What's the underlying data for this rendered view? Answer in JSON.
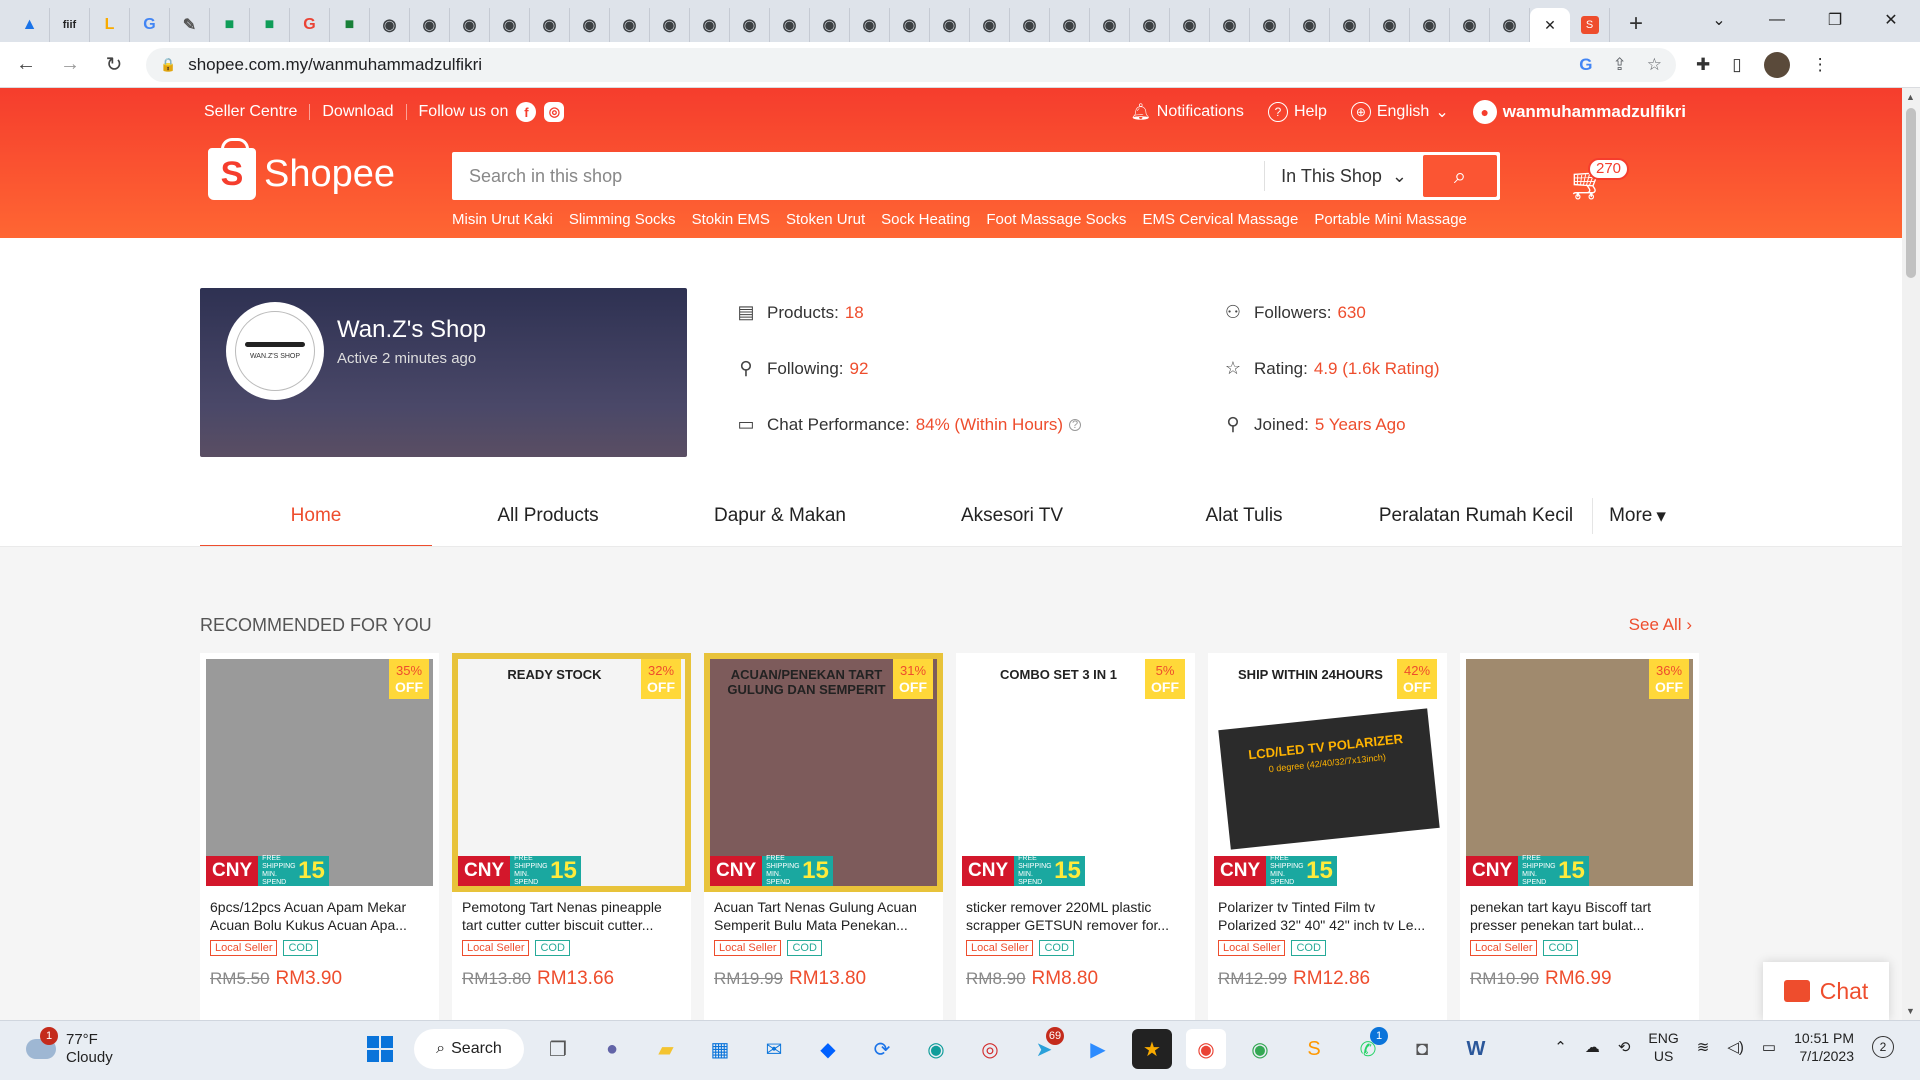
{
  "browser": {
    "tabs": [
      {
        "icon": "drive-icon",
        "char": "▲",
        "color": "#1a73e8"
      },
      {
        "icon": "fiif-icon",
        "char": "fiif",
        "color": "#222"
      },
      {
        "icon": "lucky-icon",
        "char": "L",
        "color": "#f9ab00"
      },
      {
        "icon": "translate-icon",
        "char": "G",
        "color": "#4285f4"
      },
      {
        "icon": "pen-icon",
        "char": "✎",
        "color": "#555"
      },
      {
        "icon": "classroom-icon",
        "char": "■",
        "color": "#0f9d58"
      },
      {
        "icon": "classroom-icon",
        "char": "■",
        "color": "#0f9d58"
      },
      {
        "icon": "google-icon",
        "char": "G",
        "color": "#ea4335"
      },
      {
        "icon": "classroom-icon",
        "char": "■",
        "color": "#188038"
      },
      {
        "icon": "globe-icon",
        "char": "◉",
        "color": "#3c4043"
      },
      {
        "icon": "globe-icon",
        "char": "◉",
        "color": "#3c4043"
      },
      {
        "icon": "globe-icon",
        "char": "◉",
        "color": "#3c4043"
      },
      {
        "icon": "globe-icon",
        "char": "◉",
        "color": "#3c4043"
      },
      {
        "icon": "globe-icon",
        "char": "◉",
        "color": "#3c4043"
      },
      {
        "icon": "globe-icon",
        "char": "◉",
        "color": "#3c4043"
      },
      {
        "icon": "globe-icon",
        "char": "◉",
        "color": "#3c4043"
      },
      {
        "icon": "globe-icon",
        "char": "◉",
        "color": "#3c4043"
      },
      {
        "icon": "globe-icon",
        "char": "◉",
        "color": "#3c4043"
      },
      {
        "icon": "globe-icon",
        "char": "◉",
        "color": "#3c4043"
      },
      {
        "icon": "globe-icon",
        "char": "◉",
        "color": "#3c4043"
      },
      {
        "icon": "globe-icon",
        "char": "◉",
        "color": "#3c4043"
      },
      {
        "icon": "globe-icon",
        "char": "◉",
        "color": "#3c4043"
      },
      {
        "icon": "globe-icon",
        "char": "◉",
        "color": "#3c4043"
      },
      {
        "icon": "globe-icon",
        "char": "◉",
        "color": "#3c4043"
      },
      {
        "icon": "globe-icon",
        "char": "◉",
        "color": "#3c4043"
      },
      {
        "icon": "globe-icon",
        "char": "◉",
        "color": "#3c4043"
      },
      {
        "icon": "globe-icon",
        "char": "◉",
        "color": "#3c4043"
      },
      {
        "icon": "globe-icon",
        "char": "◉",
        "color": "#3c4043"
      },
      {
        "icon": "globe-icon",
        "char": "◉",
        "color": "#3c4043"
      },
      {
        "icon": "globe-icon",
        "char": "◉",
        "color": "#3c4043"
      },
      {
        "icon": "globe-icon",
        "char": "◉",
        "color": "#3c4043"
      },
      {
        "icon": "globe-icon",
        "char": "◉",
        "color": "#3c4043"
      },
      {
        "icon": "globe-icon",
        "char": "◉",
        "color": "#3c4043"
      },
      {
        "icon": "globe-icon",
        "char": "◉",
        "color": "#3c4043"
      },
      {
        "icon": "globe-icon",
        "char": "◉",
        "color": "#3c4043"
      },
      {
        "icon": "globe-icon",
        "char": "◉",
        "color": "#3c4043"
      },
      {
        "icon": "globe-icon",
        "char": "◉",
        "color": "#3c4043"
      },
      {
        "icon": "globe-icon",
        "char": "◉",
        "color": "#3c4043"
      }
    ],
    "active_tab_close": "✕",
    "shopee_tab_char": "S",
    "new_tab": "+",
    "url": "shopee.com.my/wanmuhammadzulfikri"
  },
  "header": {
    "seller_centre": "Seller Centre",
    "download": "Download",
    "follow_us": "Follow us on",
    "notifications": "Notifications",
    "help": "Help",
    "language": "English",
    "username": "wanmuhammadzulfikri",
    "logo_text": "Shopee",
    "search_placeholder": "Search in this shop",
    "search_scope": "In This Shop",
    "cart_count": "270",
    "keywords": [
      "Misin Urut Kaki",
      "Slimming Socks",
      "Stokin EMS",
      "Stoken Urut",
      "Sock Heating",
      "Foot Massage Socks",
      "EMS Cervical Massage",
      "Portable Mini Massage"
    ]
  },
  "shop": {
    "name": "Wan.Z's Shop",
    "logo_text": "WAN.Z'S SHOP",
    "active": "Active 2 minutes ago",
    "stats": {
      "products_label": "Products:",
      "products": "18",
      "followers_label": "Followers:",
      "followers": "630",
      "following_label": "Following:",
      "following": "92",
      "rating_label": "Rating:",
      "rating": "4.9 (1.6k Rating)",
      "chat_label": "Chat Performance:",
      "chat": "84% (Within Hours)",
      "joined_label": "Joined:",
      "joined": "5 Years Ago"
    }
  },
  "tabs": [
    "Home",
    "All Products",
    "Dapur & Makan",
    "Aksesori TV",
    "Alat Tulis",
    "Peralatan Rumah Kecil"
  ],
  "more_tab": "More",
  "recommended": {
    "title": "RECOMMENDED FOR YOU",
    "see_all": "See All",
    "off_label": "OFF",
    "cny": "CNY",
    "free_ship": "FREE SHIPPING MIN. SPEND",
    "ship_amount": "15",
    "products": [
      {
        "title": "6pcs/12pcs Acuan Apam Mekar Acuan Bolu Kukus Acuan Apa...",
        "discount": "35%",
        "old_price": "RM5.50",
        "price": "RM3.90",
        "bg": "#9a9a9a",
        "frame": "#ffffff"
      },
      {
        "title": "Pemotong Tart Nenas pineapple tart cutter cutter biscuit cutter...",
        "discount": "32%",
        "old_price": "RM13.80",
        "price": "RM13.66",
        "bg": "#f4f4f4",
        "frame": "#e8c33a",
        "overlay": "READY STOCK"
      },
      {
        "title": "Acuan Tart Nenas Gulung Acuan Semperit Bulu Mata Penekan...",
        "discount": "31%",
        "old_price": "RM19.99",
        "price": "RM13.80",
        "bg": "#7d5b5b",
        "frame": "#e8c33a",
        "overlay": "ACUAN/PENEKAN TART GULUNG DAN SEMPERIT"
      },
      {
        "title": "sticker remover 220ML plastic scrapper GETSUN remover for...",
        "discount": "5%",
        "old_price": "RM8.90",
        "price": "RM8.80",
        "bg": "#ffffff",
        "frame": "#ffffff",
        "overlay": "COMBO SET 3 IN 1"
      },
      {
        "title": "Polarizer tv Tinted Film tv Polarized 32\" 40\" 42\" inch tv Le...",
        "discount": "42%",
        "old_price": "RM12.99",
        "price": "RM12.86",
        "bg": "#ffffff",
        "frame": "#ffffff",
        "overlay": "SHIP WITHIN 24HOURS",
        "overlay2": "LCD/LED TV POLARIZER",
        "overlay3": "0 degree (42/40/32/7x13inch)"
      },
      {
        "title": "penekan tart kayu Biscoff tart presser penekan tart bulat...",
        "discount": "36%",
        "old_price": "RM10.90",
        "price": "RM6.99",
        "bg": "#a08a6e",
        "frame": "#ffffff"
      }
    ],
    "local_seller": "Local Seller",
    "cod": "COD"
  },
  "chat_button": "Chat",
  "taskbar": {
    "temperature": "77°F",
    "weather": "Cloudy",
    "weather_badge": "1",
    "search": "Search",
    "telegram_badge": "69",
    "whatsapp_badge": "1",
    "lang_1": "ENG",
    "lang_2": "US",
    "time": "10:51 PM",
    "date": "7/1/2023",
    "notif_count": "2"
  },
  "colors": {
    "brand": "#ee4d2d",
    "cod": "#26aa99"
  }
}
